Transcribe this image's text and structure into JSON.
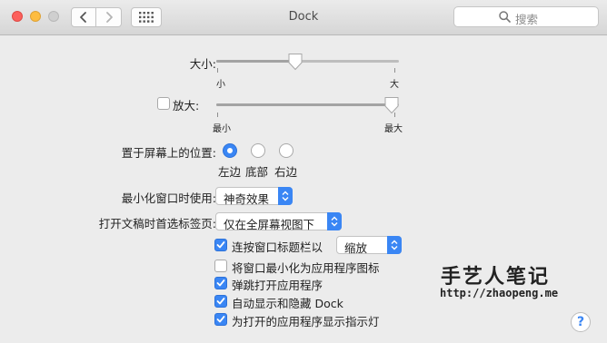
{
  "window": {
    "title": "Dock"
  },
  "search": {
    "placeholder": "搜索"
  },
  "size": {
    "label": "大小:",
    "min_label": "小",
    "max_label": "大",
    "value": 0.43
  },
  "magnification": {
    "label": "放大:",
    "checked": false,
    "min_label": "最小",
    "max_label": "最大",
    "value": 0.97
  },
  "position": {
    "label": "置于屏幕上的位置:",
    "options": [
      "左边",
      "底部",
      "右边"
    ],
    "selected": "左边"
  },
  "minimize": {
    "label": "最小化窗口时使用:",
    "value": "神奇效果"
  },
  "tabs_pref": {
    "label": "打开文稿时首选标签页:",
    "value": "仅在全屏幕视图下"
  },
  "checkboxes": [
    {
      "label": "连按窗口标题栏以",
      "checked": true,
      "popup_value": "缩放"
    },
    {
      "label": "将窗口最小化为应用程序图标",
      "checked": false
    },
    {
      "label": "弹跳打开应用程序",
      "checked": true
    },
    {
      "label": "自动显示和隐藏 Dock",
      "checked": true
    },
    {
      "label": "为打开的应用程序显示指示灯",
      "checked": true
    }
  ],
  "help": {
    "label": "?"
  },
  "watermark": {
    "title": "手艺人笔记",
    "url": "http://zhaopeng.me"
  },
  "colors": {
    "accent": "#3a86f4",
    "background": "#ececec"
  }
}
